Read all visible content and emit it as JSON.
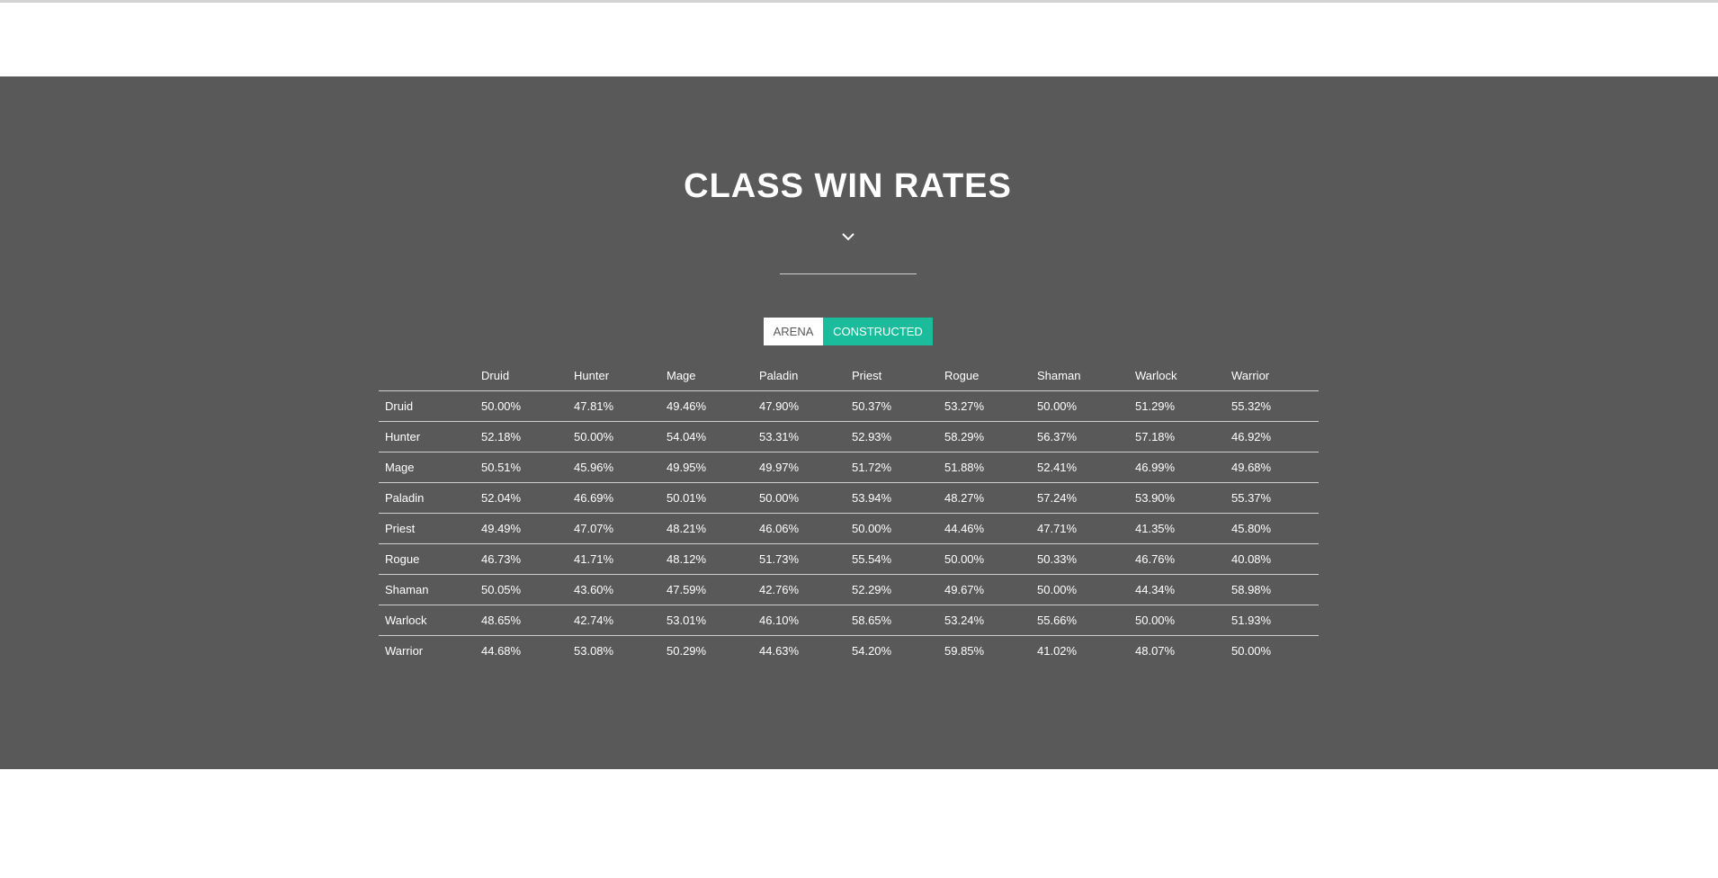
{
  "section": {
    "title": "CLASS WIN RATES",
    "toggle": {
      "arena_label": "ARENA",
      "constructed_label": "CONSTRUCTED",
      "active": "CONSTRUCTED"
    },
    "colors": {
      "background": "#595959",
      "accent": "#1abc9c",
      "text": "#ffffff"
    },
    "icons": {
      "chevron": "chevron-down-icon"
    }
  },
  "table": {
    "columns": [
      "",
      "Druid",
      "Hunter",
      "Mage",
      "Paladin",
      "Priest",
      "Rogue",
      "Shaman",
      "Warlock",
      "Warrior"
    ],
    "rows": [
      [
        "Druid",
        "50.00%",
        "47.81%",
        "49.46%",
        "47.90%",
        "50.37%",
        "53.27%",
        "50.00%",
        "51.29%",
        "55.32%"
      ],
      [
        "Hunter",
        "52.18%",
        "50.00%",
        "54.04%",
        "53.31%",
        "52.93%",
        "58.29%",
        "56.37%",
        "57.18%",
        "46.92%"
      ],
      [
        "Mage",
        "50.51%",
        "45.96%",
        "49.95%",
        "49.97%",
        "51.72%",
        "51.88%",
        "52.41%",
        "46.99%",
        "49.68%"
      ],
      [
        "Paladin",
        "52.04%",
        "46.69%",
        "50.01%",
        "50.00%",
        "53.94%",
        "48.27%",
        "57.24%",
        "53.90%",
        "55.37%"
      ],
      [
        "Priest",
        "49.49%",
        "47.07%",
        "48.21%",
        "46.06%",
        "50.00%",
        "44.46%",
        "47.71%",
        "41.35%",
        "45.80%"
      ],
      [
        "Rogue",
        "46.73%",
        "41.71%",
        "48.12%",
        "51.73%",
        "55.54%",
        "50.00%",
        "50.33%",
        "46.76%",
        "40.08%"
      ],
      [
        "Shaman",
        "50.05%",
        "43.60%",
        "47.59%",
        "42.76%",
        "52.29%",
        "49.67%",
        "50.00%",
        "44.34%",
        "58.98%"
      ],
      [
        "Warlock",
        "48.65%",
        "42.74%",
        "53.01%",
        "46.10%",
        "58.65%",
        "53.24%",
        "55.66%",
        "50.00%",
        "51.93%"
      ],
      [
        "Warrior",
        "44.68%",
        "53.08%",
        "50.29%",
        "44.63%",
        "54.20%",
        "59.85%",
        "41.02%",
        "48.07%",
        "50.00%"
      ]
    ]
  }
}
